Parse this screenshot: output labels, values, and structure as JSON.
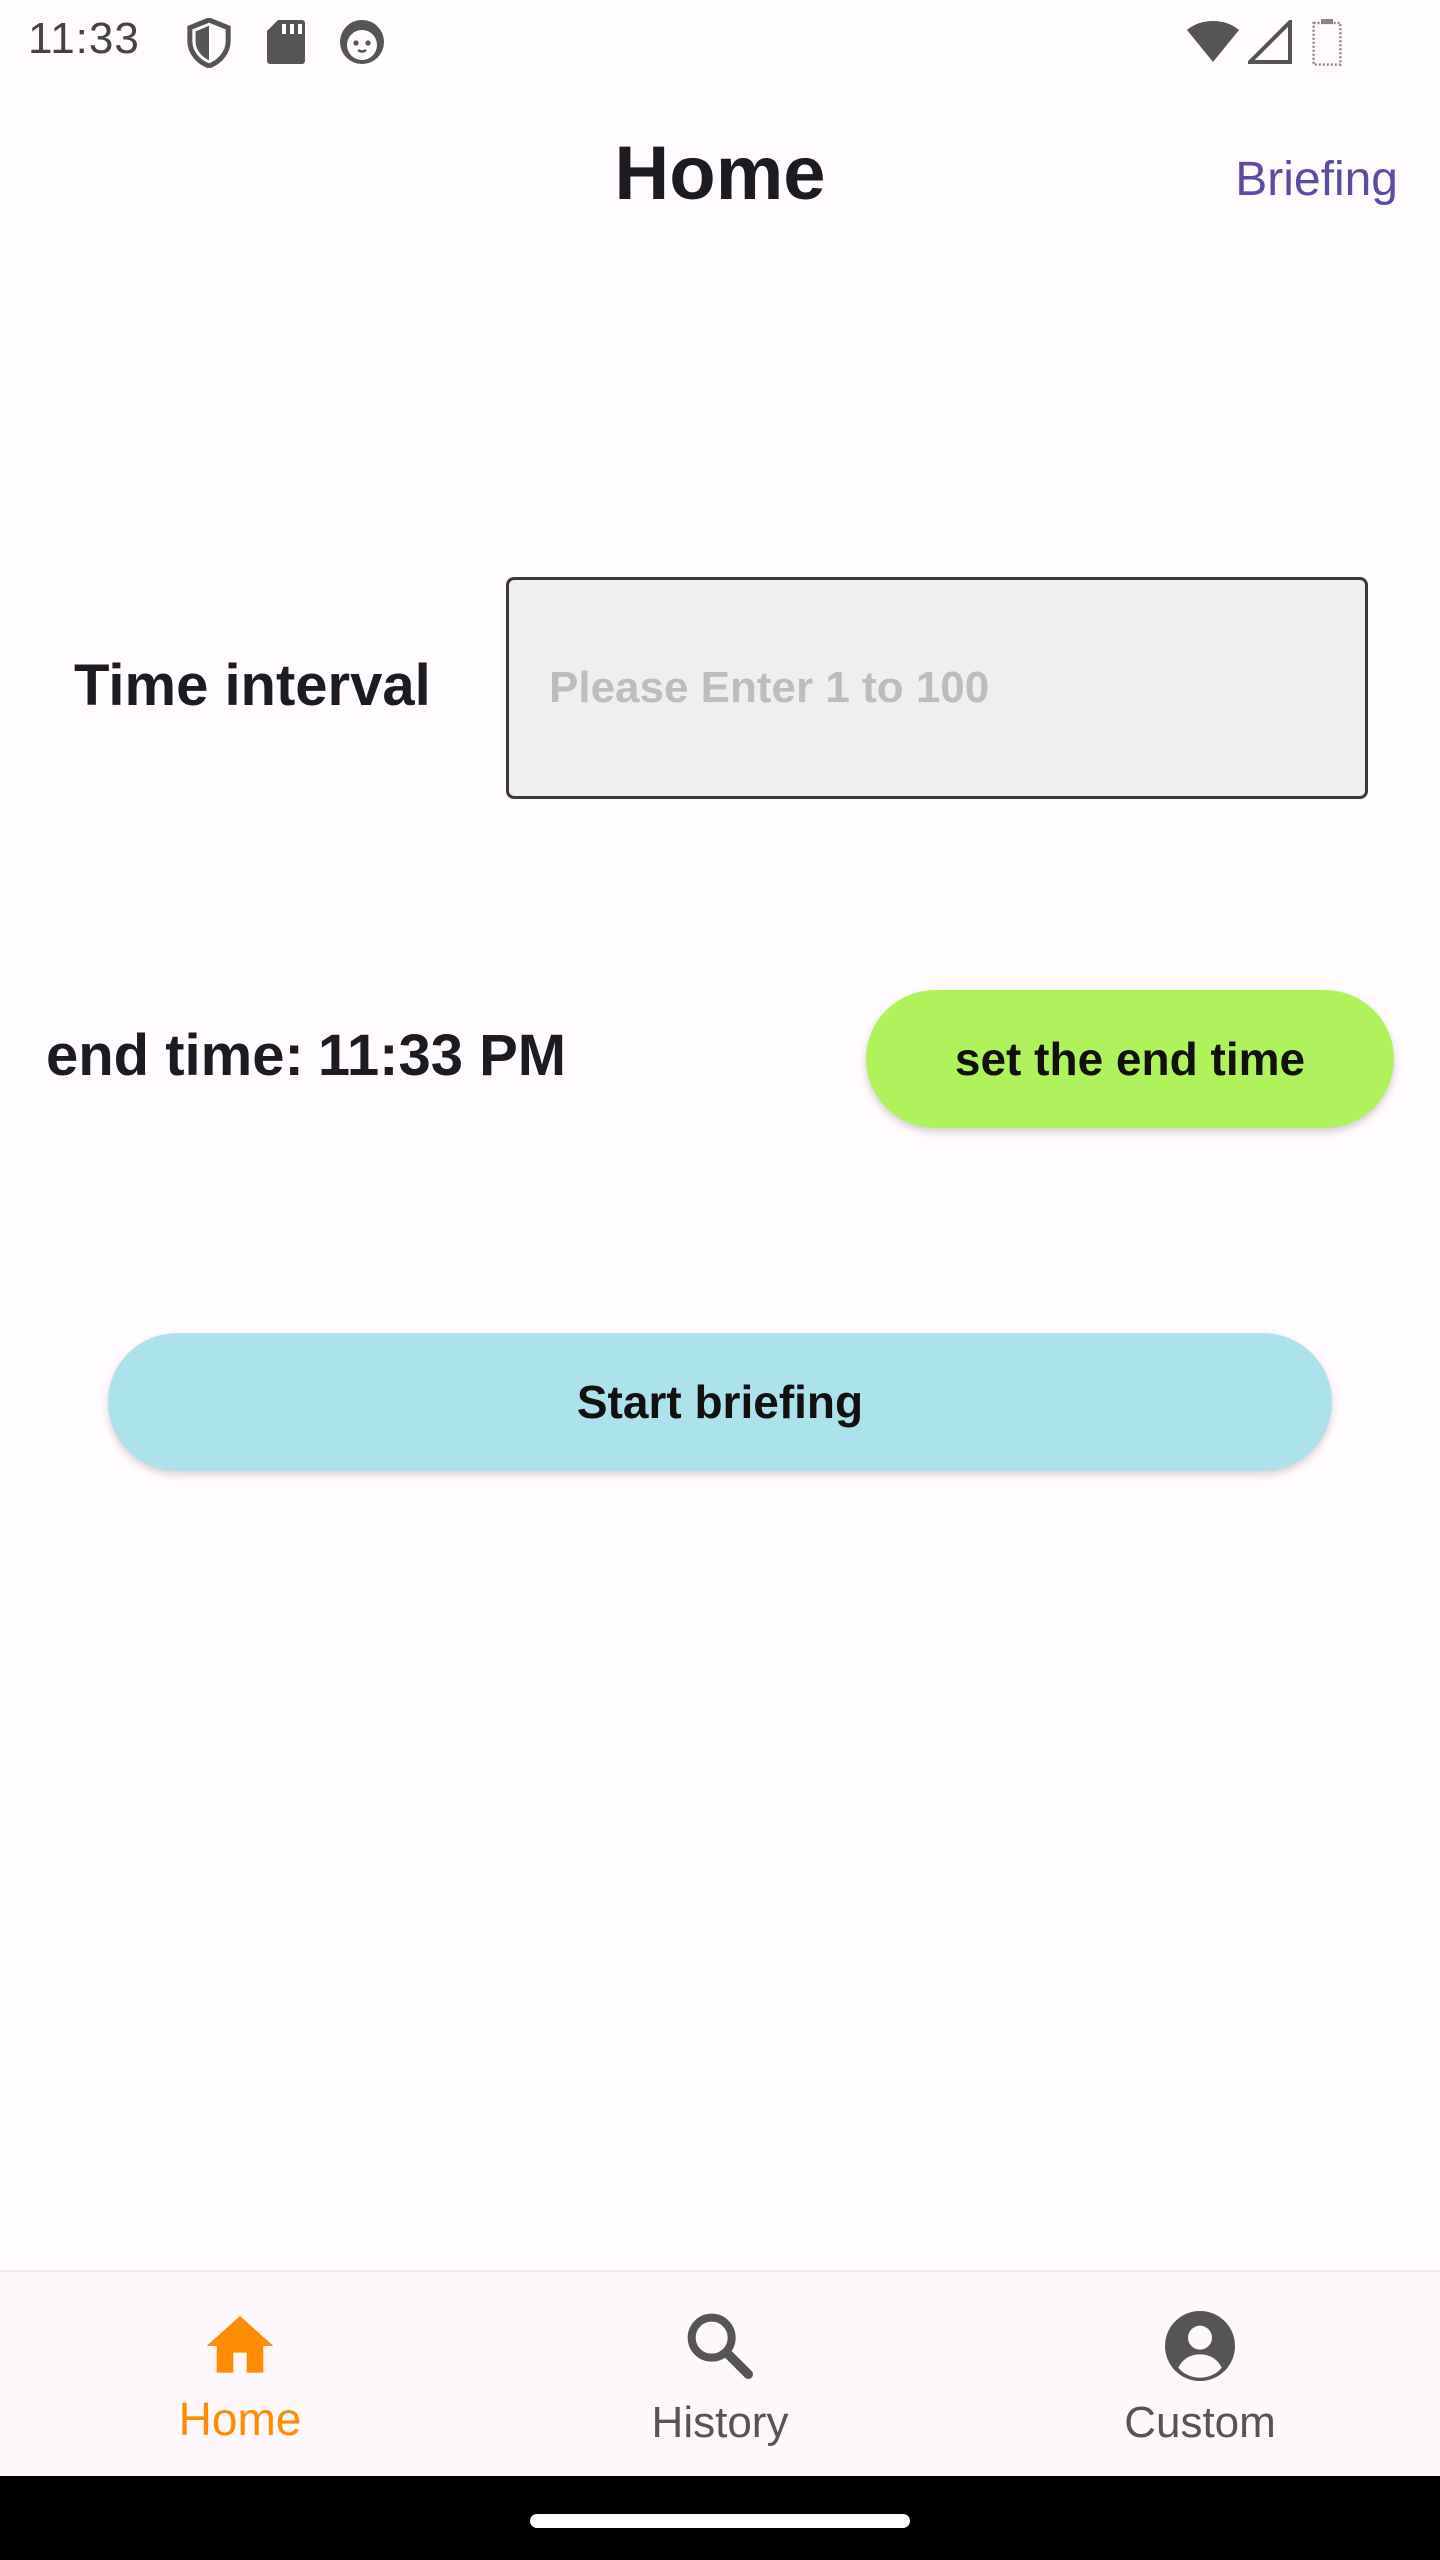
{
  "status_bar": {
    "time": "11:33",
    "icons": [
      "shield-icon",
      "sd-card-icon",
      "cat-face-icon",
      "wifi-icon",
      "signal-icon",
      "battery-icon"
    ]
  },
  "app_bar": {
    "title": "Home",
    "action_label": "Briefing",
    "action_color": "#5B4CA3"
  },
  "form": {
    "interval_label": "Time interval",
    "interval_placeholder": "Please Enter 1 to 100",
    "interval_value": "",
    "end_time_prefix": "end time:",
    "end_time_value": "11:33 PM",
    "set_end_time_label": "set the end time",
    "set_end_time_color": "#AEF35B",
    "start_label": "Start briefing",
    "start_color": "#ACE2EB"
  },
  "bottom_nav": {
    "active_color": "#FF8C00",
    "items": [
      {
        "label": "Home",
        "icon": "home-icon",
        "active": true
      },
      {
        "label": "History",
        "icon": "search-icon",
        "active": false
      },
      {
        "label": "Custom",
        "icon": "account-icon",
        "active": false
      }
    ]
  }
}
